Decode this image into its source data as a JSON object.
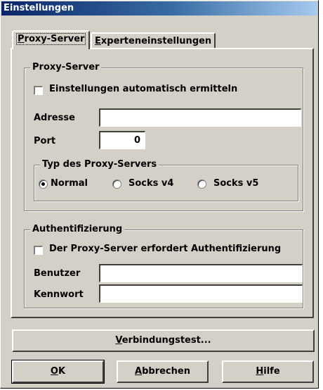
{
  "window": {
    "title": "Einstellungen"
  },
  "tabs": [
    {
      "label": "Proxy-Server",
      "mnemonic": "P",
      "rest": "roxy-Server",
      "active": true
    },
    {
      "label": "Experteneinstellungen",
      "mnemonic": "E",
      "rest": "xperteneinstellungen",
      "active": false
    }
  ],
  "proxy_group": {
    "title": "Proxy-Server",
    "auto_detect_label": "Einstellungen automatisch ermitteln",
    "auto_detect_checked": false,
    "address_label": "Adresse",
    "address_value": "",
    "port_label": "Port",
    "port_value": "0",
    "type_group": {
      "title": "Typ des Proxy-Servers",
      "options": [
        "Normal",
        "Socks v4",
        "Socks v5"
      ],
      "selected": "Normal"
    }
  },
  "auth_group": {
    "title": "Authentifizierung",
    "required_label": "Der Proxy-Server erfordert Authentifizierung",
    "required_checked": false,
    "user_label": "Benutzer",
    "user_value": "",
    "password_label": "Kennwort",
    "password_value": ""
  },
  "buttons": {
    "test": {
      "mnemonic": "V",
      "rest": "erbindungstest..."
    },
    "ok": {
      "mnemonic": "O",
      "rest": "K"
    },
    "cancel": {
      "mnemonic": "A",
      "rest": "bbrechen"
    },
    "help": {
      "mnemonic": "H",
      "rest": "ilfe"
    }
  }
}
